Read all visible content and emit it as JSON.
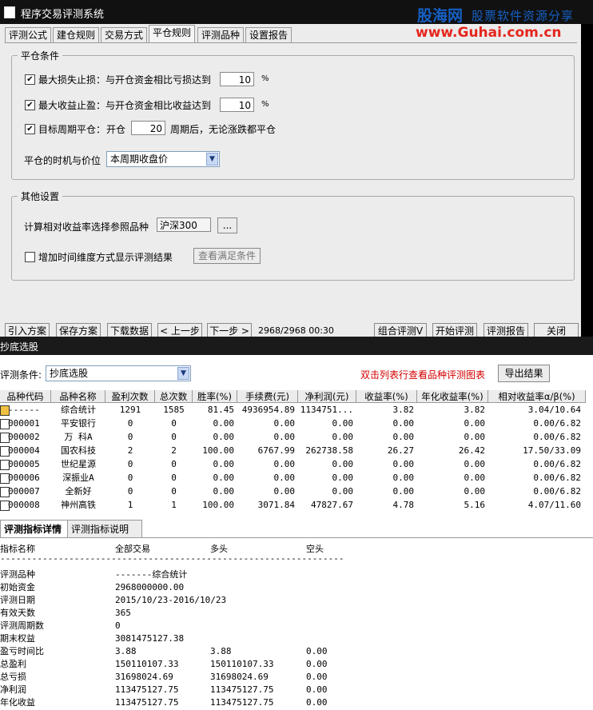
{
  "window": {
    "title": "程序交易评测系统"
  },
  "watermark": {
    "brand": "股海网",
    "slogan": "股票软件资源分享",
    "url": "www.Guhai.com.cn"
  },
  "tabs": [
    "评测公式",
    "建仓规则",
    "交易方式",
    "平仓规则",
    "评测品种",
    "设置报告"
  ],
  "selected_tab": "平仓规则",
  "close_conditions": {
    "title": "平仓条件",
    "stop_loss_label": "最大损失止损：与开仓资金相比亏损达到",
    "stop_loss_value": "10",
    "take_profit_label": "最大收益止盈：与开仓资金相比收益达到",
    "take_profit_value": "10",
    "percent": "%",
    "target_period_label": "目标周期平仓：",
    "open_label": "开仓",
    "period_value": "20",
    "period_suffix": "周期后，无论涨跌都平仓",
    "timing_label": "平仓的时机与价位",
    "timing_value": "本周期收盘价"
  },
  "other_settings": {
    "title": "其他设置",
    "ref_label": "计算相对收益率选择参照品种",
    "ref_value": "沪深300",
    "browse_label": "...",
    "time_dim_label": "增加时间维度方式显示评测结果",
    "view_label": "查看满足条件"
  },
  "bottom_buttons": {
    "import": "引入方案",
    "save": "保存方案",
    "download": "下载数据",
    "prev": "< 上一步",
    "next": "下一步 >",
    "progress": "2968/2968 00:30",
    "combo": "组合评测V",
    "start": "开始评测",
    "report": "评测报告",
    "close": "关闭"
  },
  "result_window": {
    "title": "抄底选股",
    "condition_label": "评测条件:",
    "condition_value": "抄底选股",
    "hint": "双击列表行查看品种评测图表",
    "export": "导出结果"
  },
  "table": {
    "headers": [
      "品种代码",
      "品种名称",
      "盈利次数",
      "总次数",
      "胜率(%)",
      "手续费(元)",
      "净利润(元)",
      "收益率(%)",
      "年化收益率(%)",
      "相对收益率α/β(%)"
    ],
    "rows": [
      [
        "------",
        "综合统计",
        "1291",
        "1585",
        "81.45",
        "4936954.89",
        "1134751...",
        "3.82",
        "3.82",
        "3.04/10.64"
      ],
      [
        "000001",
        "平安银行",
        "0",
        "0",
        "0.00",
        "0.00",
        "0.00",
        "0.00",
        "0.00",
        "0.00/6.82"
      ],
      [
        "000002",
        "万 科A",
        "0",
        "0",
        "0.00",
        "0.00",
        "0.00",
        "0.00",
        "0.00",
        "0.00/6.82"
      ],
      [
        "000004",
        "国农科技",
        "2",
        "2",
        "100.00",
        "6767.99",
        "262738.58",
        "26.27",
        "26.42",
        "17.50/33.09"
      ],
      [
        "000005",
        "世纪星源",
        "0",
        "0",
        "0.00",
        "0.00",
        "0.00",
        "0.00",
        "0.00",
        "0.00/6.82"
      ],
      [
        "000006",
        "深振业A",
        "0",
        "0",
        "0.00",
        "0.00",
        "0.00",
        "0.00",
        "0.00",
        "0.00/6.82"
      ],
      [
        "000007",
        "全新好",
        "0",
        "0",
        "0.00",
        "0.00",
        "0.00",
        "0.00",
        "0.00",
        "0.00/6.82"
      ],
      [
        "000008",
        "神州高铁",
        "1",
        "1",
        "100.00",
        "3071.84",
        "47827.67",
        "4.78",
        "5.16",
        "4.07/11.60"
      ]
    ]
  },
  "detail_tabs": [
    "评测指标详情",
    "评测指标说明"
  ],
  "detail": {
    "headers": [
      "指标名称",
      "全部交易",
      "多头",
      "空头"
    ],
    "divider": "--------------------------------------------------------------------------------------",
    "rows": [
      [
        "评测品种",
        "-------综合统计",
        "",
        ""
      ],
      [
        "初始资金",
        "2968000000.00",
        "",
        ""
      ],
      [
        "评测日期",
        "2015/10/23-2016/10/23",
        "",
        ""
      ],
      [
        "有效天数",
        "365",
        "",
        ""
      ],
      [
        "评测周期数",
        "0",
        "",
        ""
      ],
      [
        "期末权益",
        "3081475127.38",
        "",
        ""
      ],
      [
        "盈亏时间比",
        "3.88",
        "3.88",
        "0.00"
      ],
      [
        "总盈利",
        "150110107.33",
        "150110107.33",
        "0.00"
      ],
      [
        "总亏损",
        "31698024.69",
        "31698024.69",
        "0.00"
      ],
      [
        "净利润",
        "113475127.75",
        "113475127.75",
        "0.00"
      ],
      [
        "年化收益",
        "113475127.75",
        "113475127.75",
        "0.00"
      ]
    ]
  }
}
